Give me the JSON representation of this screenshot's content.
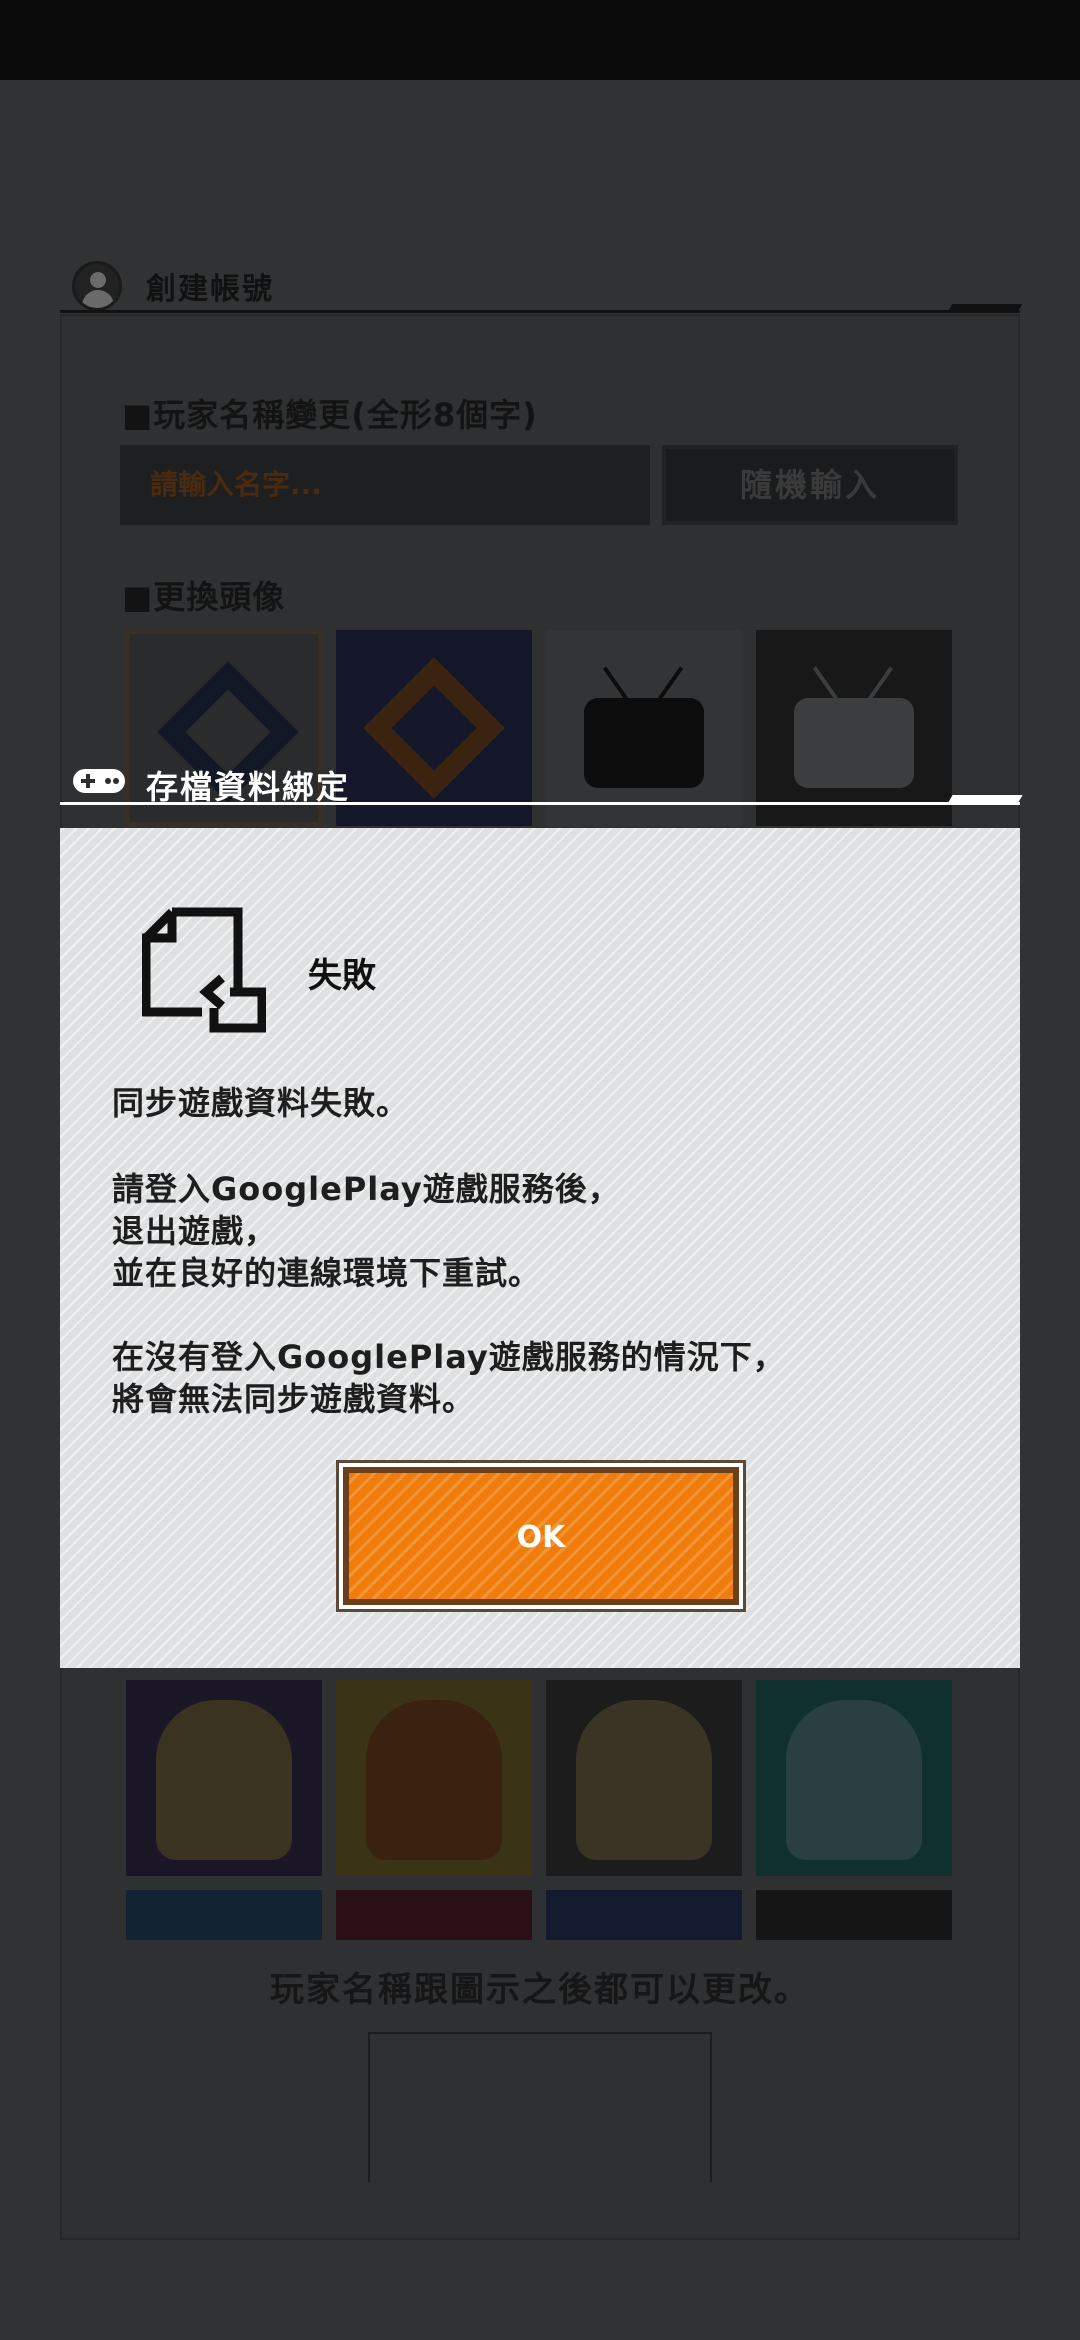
{
  "background_screen": {
    "header_title": "創建帳號",
    "name_section_label": "■玩家名稱變更(全形8個字)",
    "name_input_placeholder": "請輸入名字...",
    "random_button_label": "隨機輸入",
    "avatar_section_label": "■更換頭像",
    "bottom_note": "玩家名稱跟圖示之後都可以更改。"
  },
  "dialog": {
    "header_title": "存檔資料綁定",
    "header_icon": "gamepad-icon",
    "status_icon": "sync-fail-icon",
    "status_title": "失敗",
    "message_lines": [
      "同步遊戲資料失敗。",
      "請登入GooglePlay遊戲服務後，",
      "退出遊戲，",
      "並在良好的連線環境下重試。",
      "在沒有登入GooglePlay遊戲服務的情況下，",
      "將會無法同步遊戲資料。"
    ],
    "ok_button_label": "OK"
  },
  "colors": {
    "overlay": "#2b2c2d",
    "dialog_panel": "#dfe0e1",
    "ok_button": "#f07c0c",
    "ok_border": "#6b3f1c"
  }
}
